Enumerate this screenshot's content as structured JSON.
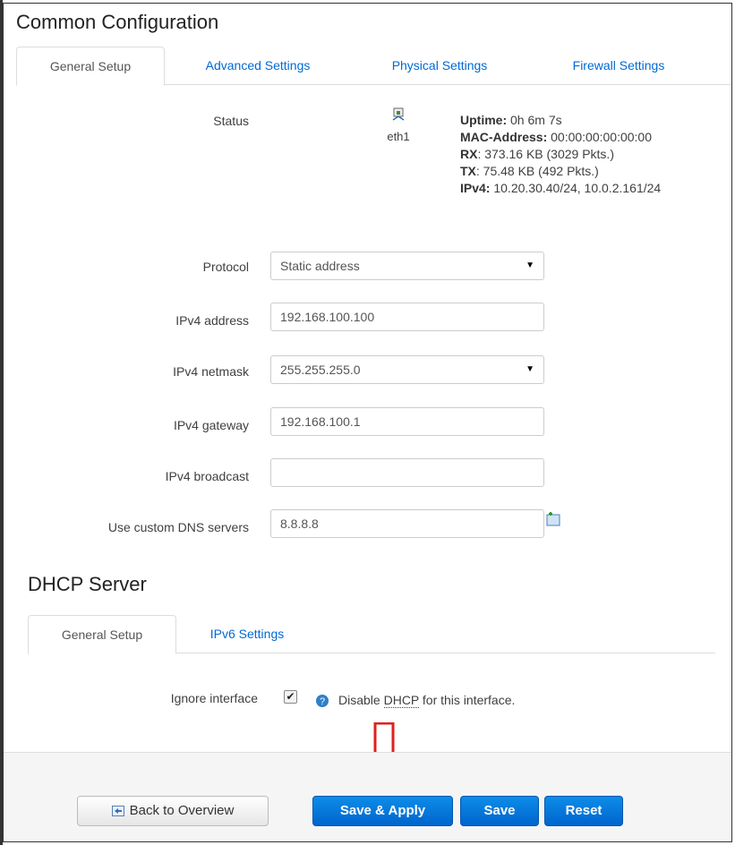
{
  "common": {
    "title": "Common Configuration",
    "tabs": [
      "General Setup",
      "Advanced Settings",
      "Physical Settings",
      "Firewall Settings"
    ]
  },
  "status": {
    "label": "Status",
    "iface": "eth1",
    "uptime_label": "Uptime:",
    "uptime": "0h 6m 7s",
    "mac_label": "MAC-Address:",
    "mac": "00:00:00:00:00:00",
    "rx_label": "RX",
    "rx": ": 373.16 KB (3029 Pkts.)",
    "tx_label": "TX",
    "tx": ": 75.48 KB (492 Pkts.)",
    "ipv4_label": "IPv4:",
    "ipv4": "10.20.30.40/24, 10.0.2.161/24"
  },
  "form": {
    "protocol_label": "Protocol",
    "protocol_value": "Static address",
    "ipv4_address_label": "IPv4 address",
    "ipv4_address_value": "192.168.100.100",
    "ipv4_netmask_label": "IPv4 netmask",
    "ipv4_netmask_value": "255.255.255.0",
    "ipv4_gateway_label": "IPv4 gateway",
    "ipv4_gateway_value": "192.168.100.1",
    "ipv4_broadcast_label": "IPv4 broadcast",
    "ipv4_broadcast_value": "",
    "dns_label": "Use custom DNS servers",
    "dns_value": "8.8.8.8"
  },
  "dhcp": {
    "title": "DHCP Server",
    "tabs": [
      "General Setup",
      "IPv6 Settings"
    ],
    "ignore_label": "Ignore interface",
    "ignore_checked": true,
    "hint_prefix": "Disable ",
    "hint_dhcp": "DHCP",
    "hint_suffix": " for this interface."
  },
  "footer": {
    "back": "Back to Overview",
    "save_apply": "Save & Apply",
    "save": "Save",
    "reset": "Reset"
  },
  "colors": {
    "link": "#0069d6",
    "primary": "#0069d6",
    "arrow": "#e02020"
  }
}
